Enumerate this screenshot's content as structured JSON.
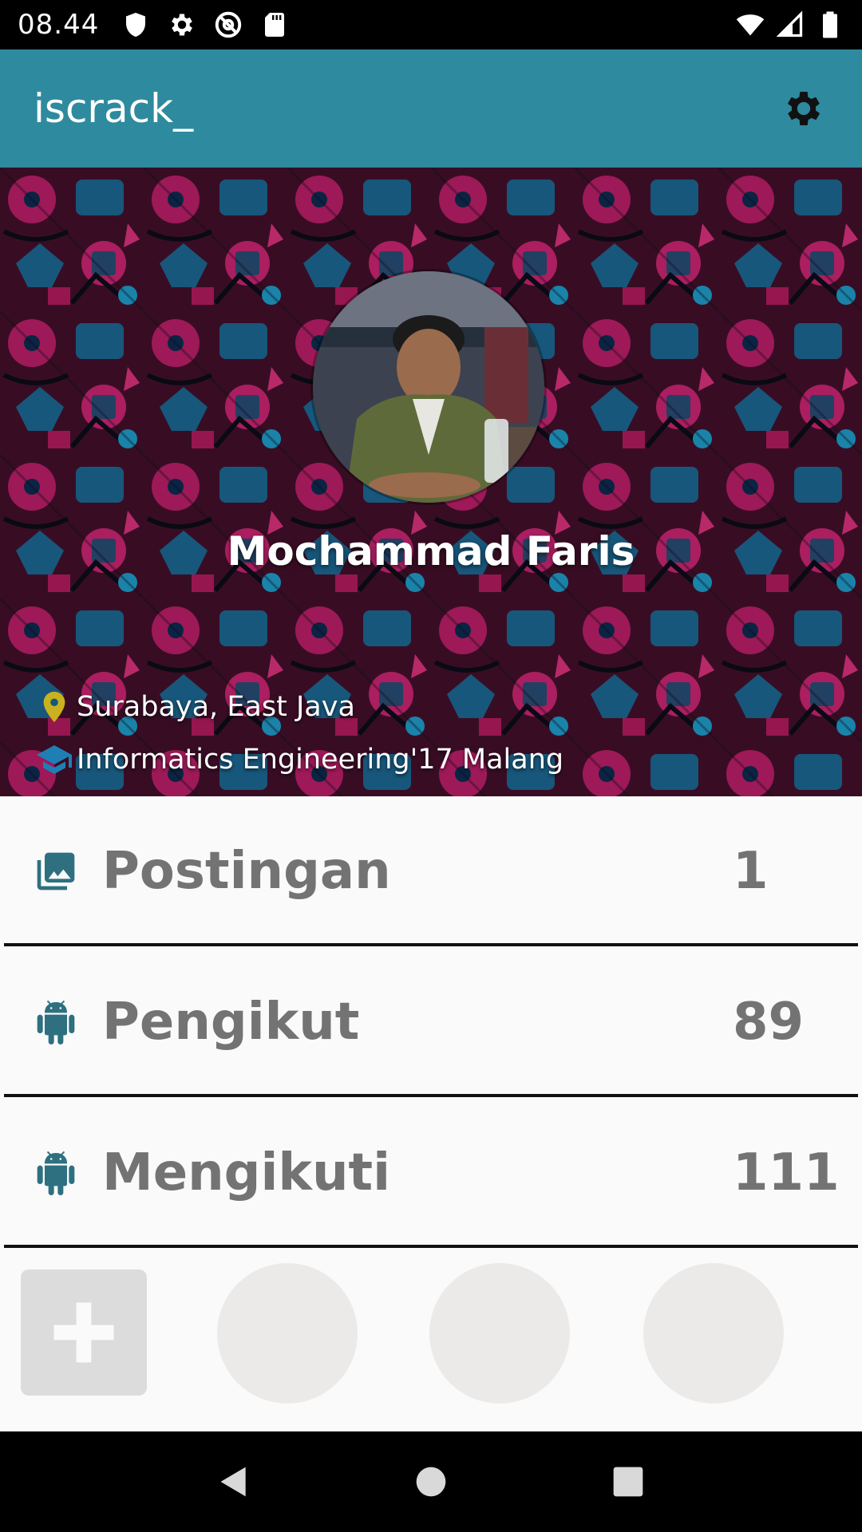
{
  "status_bar": {
    "time": "08.44",
    "left_icons": [
      "shield-icon",
      "gear-icon",
      "at-sign-icon",
      "sd-card-icon"
    ],
    "right_icons": [
      "wifi-icon",
      "signal-icon",
      "battery-icon"
    ]
  },
  "app_bar": {
    "title": "iscrack_",
    "settings_icon": "gear-icon"
  },
  "profile": {
    "name": "Mochammad Faris",
    "location": "Surabaya, East Java",
    "education": "Informatics Engineering'17 Malang",
    "location_icon": "map-pin-icon",
    "education_icon": "graduation-cap-icon",
    "location_icon_color": "#c9b21d",
    "education_icon_color": "#1f7fb5"
  },
  "stats": [
    {
      "label": "Postingan",
      "value": "1",
      "icon": "photo-library-icon"
    },
    {
      "label": "Pengikut",
      "value": "89",
      "icon": "android-icon"
    },
    {
      "label": "Mengikuti",
      "value": "111",
      "icon": "android-icon"
    }
  ],
  "gallery": {
    "add_icon": "plus-icon",
    "placeholders": 3
  },
  "colors": {
    "app_bar": "#2e8a9e",
    "stat_text": "#737373",
    "stat_icon": "#2e7080"
  },
  "nav_bar": {
    "buttons": [
      "back-icon",
      "home-icon",
      "recents-icon"
    ]
  }
}
